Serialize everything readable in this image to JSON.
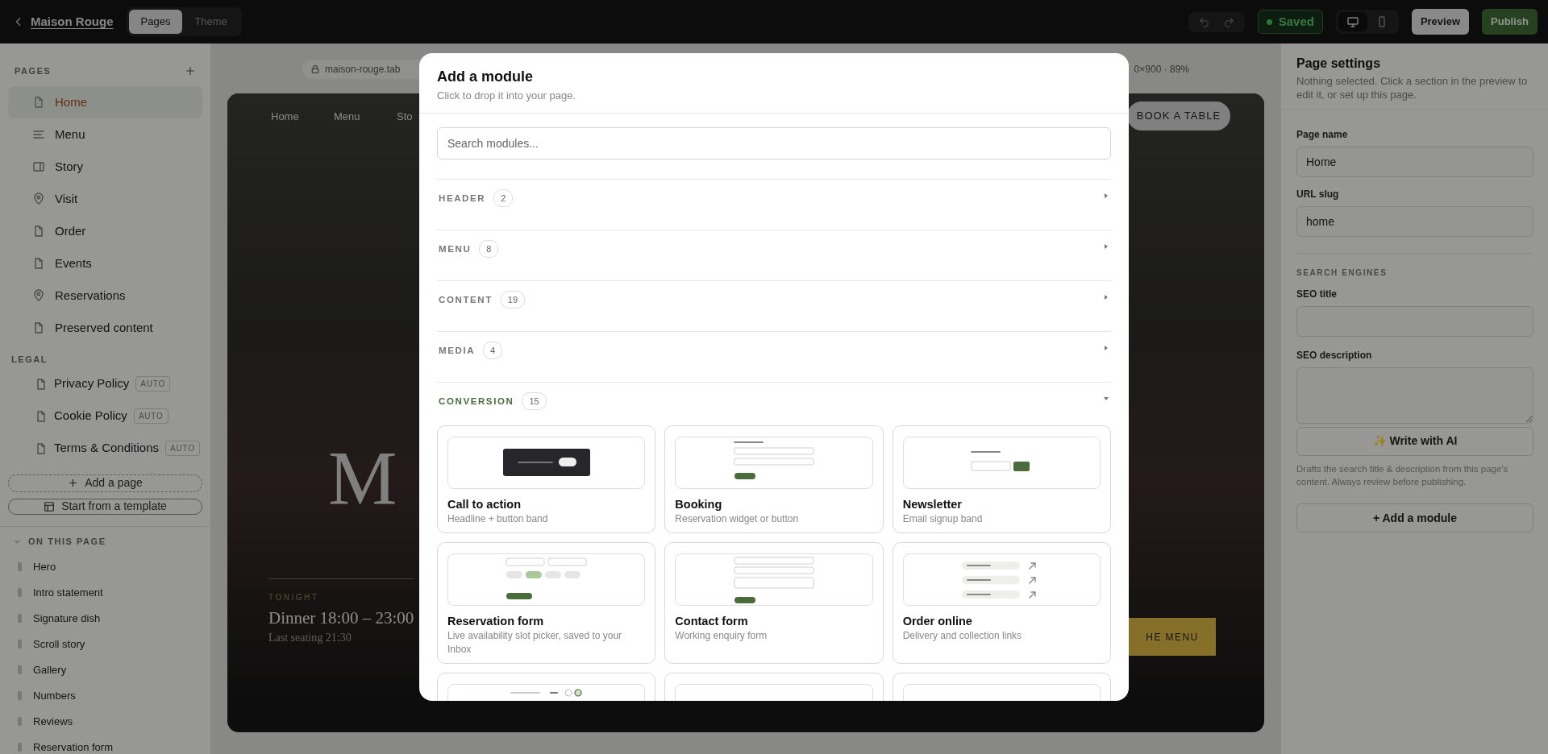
{
  "topbar": {
    "back_label": "Maison Rouge",
    "tabs": [
      {
        "label": "Pages",
        "selected": true
      },
      {
        "label": "Theme",
        "selected": false
      }
    ],
    "status": "Saved",
    "devices": [
      {
        "kind": "desktop",
        "selected": true
      },
      {
        "kind": "mobile",
        "selected": false
      }
    ],
    "preview_button": "Preview",
    "publish_button": "Publish"
  },
  "sidebar": {
    "pages_heading": "PAGES",
    "pages": [
      {
        "label": "Home",
        "kind": "document",
        "selected": true
      },
      {
        "label": "Menu",
        "kind": "lines",
        "selected": false
      },
      {
        "label": "Story",
        "kind": "book",
        "selected": false
      },
      {
        "label": "Visit",
        "kind": "pin",
        "selected": false
      },
      {
        "label": "Order",
        "kind": "document",
        "selected": false
      },
      {
        "label": "Events",
        "kind": "document",
        "selected": false
      },
      {
        "label": "Reservations",
        "kind": "pin",
        "selected": false
      },
      {
        "label": "Preserved content",
        "kind": "document",
        "selected": false
      }
    ],
    "legal_heading": "LEGAL",
    "legal_pages": [
      {
        "label": "Privacy Policy",
        "badge": "AUTO",
        "selected": false
      },
      {
        "label": "Cookie Policy",
        "badge": "AUTO",
        "selected": false
      },
      {
        "label": "Terms & Conditions",
        "badge": "AUTO",
        "selected": false
      }
    ],
    "add_page_button": "Add a page",
    "template_button": "Start from a template",
    "on_this_page": {
      "heading": "ON THIS PAGE",
      "expanded": true,
      "sections": [
        "Hero",
        "Intro statement",
        "Signature dish",
        "Scroll story",
        "Gallery",
        "Numbers",
        "Reviews",
        "Reservation form"
      ]
    }
  },
  "preview": {
    "url": "maison-rouge.tab",
    "size_label": "0×900 · 89%",
    "nav": [
      "Home",
      "Menu",
      "Sto"
    ],
    "book_button": "BOOK A TABLE",
    "hero_letter": "M",
    "eyebrow": "TONIGHT",
    "hours": "Dinner 18:00 – 23:00",
    "last_seating": "Last seating 21:30",
    "menu_button": "HE MENU"
  },
  "modal": {
    "title": "Add a module",
    "subtitle": "Click to drop it into your page.",
    "search": {
      "placeholder": "Search modules..."
    },
    "sections": [
      {
        "label": "HEADER",
        "count": "2",
        "expanded": false
      },
      {
        "label": "MENU",
        "count": "8",
        "expanded": false
      },
      {
        "label": "CONTENT",
        "count": "19",
        "expanded": false
      },
      {
        "label": "MEDIA",
        "count": "4",
        "expanded": false
      },
      {
        "label": "CONVERSION",
        "count": "15",
        "expanded": true
      }
    ],
    "modules": [
      {
        "kind": "cta",
        "title": "Call to action",
        "description": "Headline + button band"
      },
      {
        "kind": "booking",
        "title": "Booking",
        "description": "Reservation widget or button"
      },
      {
        "kind": "newsletter",
        "title": "Newsletter",
        "description": "Email signup band"
      },
      {
        "kind": "reservation",
        "title": "Reservation form",
        "description": "Live availability slot picker, saved to your Inbox"
      },
      {
        "kind": "contact",
        "title": "Contact form",
        "description": "Working enquiry form"
      },
      {
        "kind": "order",
        "title": "Order online",
        "description": "Delivery and collection links"
      }
    ],
    "cut_modules": [
      {
        "kind": "steps"
      },
      {
        "kind": "blank"
      },
      {
        "kind": "blank"
      }
    ]
  },
  "page_settings": {
    "title": "Page settings",
    "description": "Nothing selected. Click a section in the preview to edit it, or set up this page.",
    "page_name": {
      "label": "Page name",
      "value": "Home"
    },
    "url_slug": {
      "label": "URL slug",
      "value": "home"
    },
    "seo_heading": "SEARCH ENGINES",
    "seo_title": {
      "label": "SEO title"
    },
    "seo_description": {
      "label": "SEO description"
    },
    "ai_button": "✨ Write with AI",
    "ai_help": "Drafts the search title & description from this page's content. Always review before publishing.",
    "add_module_button": "+ Add a module"
  }
}
